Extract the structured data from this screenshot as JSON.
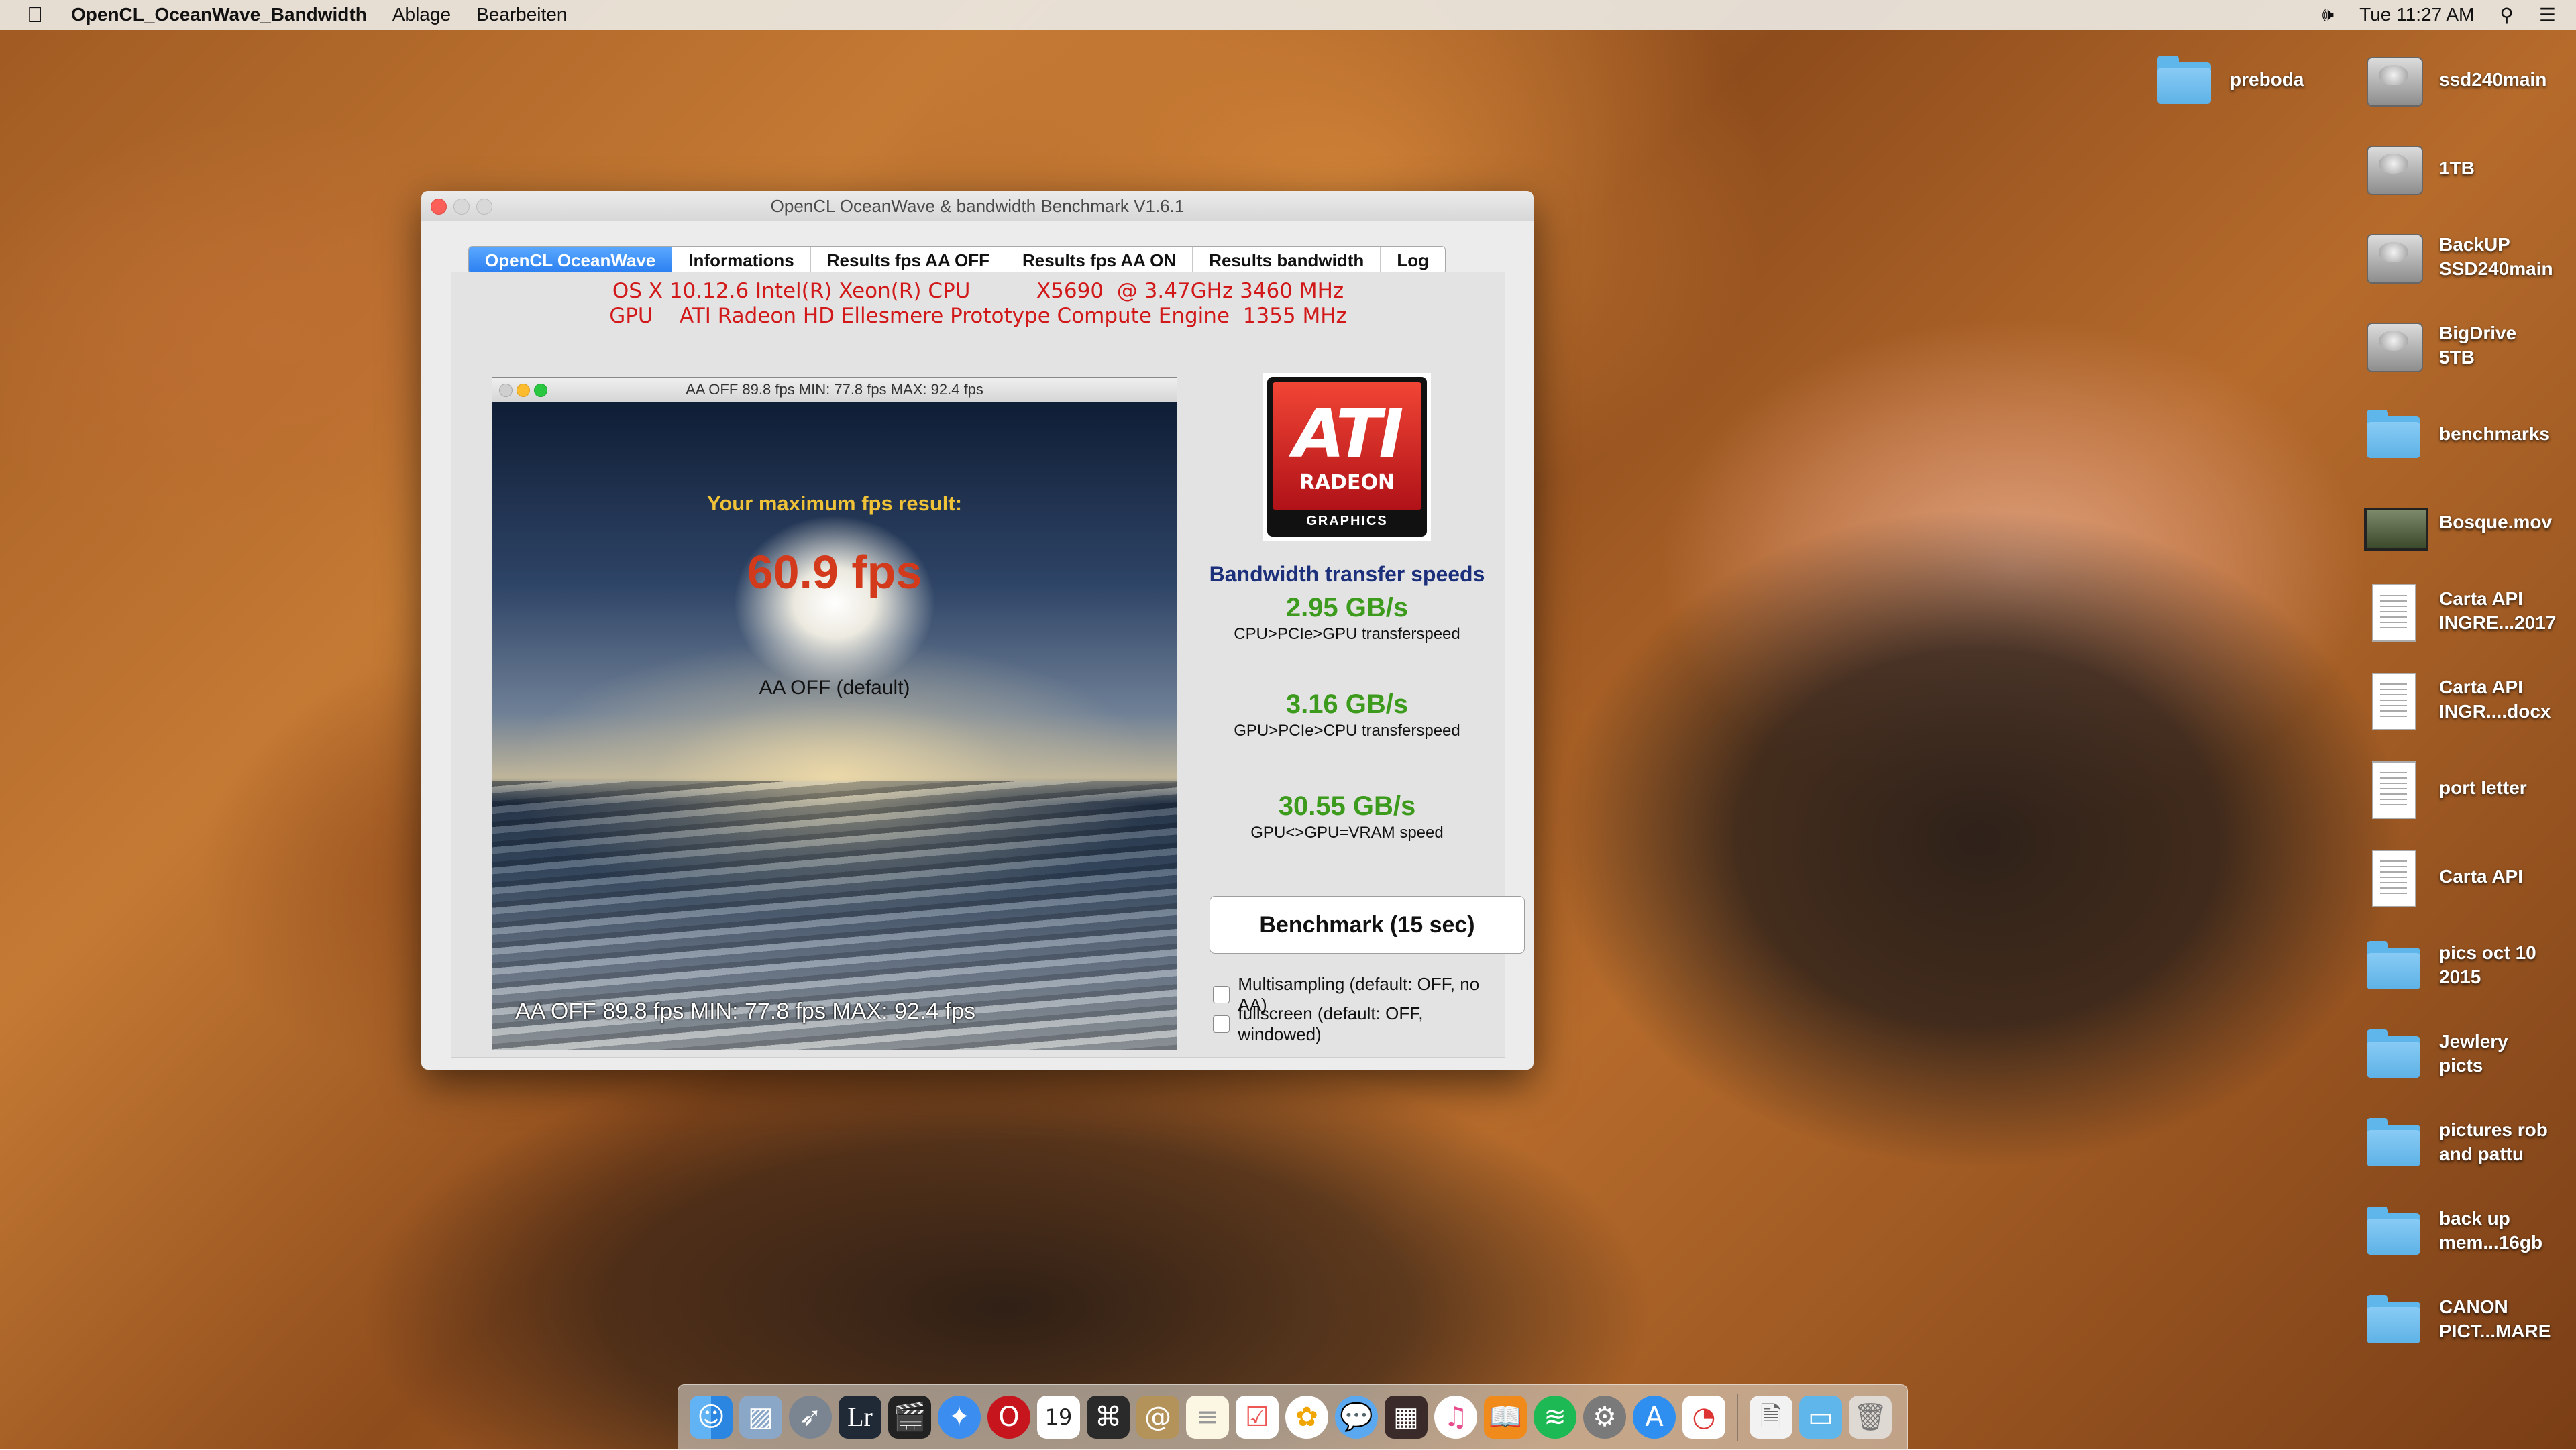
{
  "menubar": {
    "app_name": "OpenCL_OceanWave_Bandwidth",
    "menus": [
      "Ablage",
      "Bearbeiten"
    ],
    "clock": "Tue 11:27 AM"
  },
  "desktop_icons": [
    {
      "label": "preboda",
      "icon": "folder-icon"
    },
    {
      "label": "ssd240main",
      "icon": "hard-drive-icon"
    },
    {
      "label": "1TB",
      "icon": "hard-drive-icon"
    },
    {
      "label": "BackUP\nSSD240main",
      "icon": "hard-drive-icon"
    },
    {
      "label": "BigDrive\n5TB",
      "icon": "hard-drive-icon"
    },
    {
      "label": "benchmarks",
      "icon": "folder-icon"
    },
    {
      "label": "Bosque.mov",
      "icon": "movie-file-icon"
    },
    {
      "label": "Carta API\nINGRE...2017",
      "icon": "document-icon"
    },
    {
      "label": "Carta API\nINGR....docx",
      "icon": "docx-icon"
    },
    {
      "label": "port letter",
      "icon": "document-icon"
    },
    {
      "label": "Carta API",
      "icon": "docx-icon"
    },
    {
      "label": "pics oct 10\n2015",
      "icon": "folder-icon"
    },
    {
      "label": "Jewlery\npicts",
      "icon": "folder-icon"
    },
    {
      "label": "pictures rob\nand pattu",
      "icon": "folder-icon"
    },
    {
      "label": "back up\nmem...16gb",
      "icon": "folder-icon"
    },
    {
      "label": "CANON\nPICT...MARE",
      "icon": "folder-icon"
    }
  ],
  "window": {
    "title": "OpenCL OceanWave & bandwidth Benchmark V1.6.1",
    "tabs": [
      "OpenCL OceanWave",
      "Informations",
      "Results fps AA OFF",
      "Results fps AA ON",
      "Results bandwidth",
      "Log"
    ],
    "active_tab": 0,
    "sysinfo_line1": "OS X 10.12.6 Intel(R) Xeon(R) CPU          X5690  @ 3.47GHz 3460 MHz",
    "sysinfo_line2": "GPU    ATI Radeon HD Ellesmere Prototype Compute Engine  1355 MHz",
    "render_window": {
      "title": "AA OFF   89.8 fps MIN: 77.8 fps MAX: 92.4 fps",
      "max_fps_label": "Your maximum fps result:",
      "max_fps_value": "60.9 fps",
      "aa_mode": "AA OFF (default)",
      "overlay_text": "AA OFF   89.8 fps MIN: 77.8 fps MAX: 92.4 fps"
    },
    "logo": {
      "brand": "ATI",
      "line2": "RADEON",
      "line3": "GRAPHICS"
    },
    "bandwidth": {
      "title": "Bandwidth transfer speeds",
      "items": [
        {
          "value": "2.95 GB/s",
          "desc": "CPU>PCIe>GPU transferspeed"
        },
        {
          "value": "3.16 GB/s",
          "desc": "GPU>PCIe>CPU transferspeed"
        },
        {
          "value": "30.55 GB/s",
          "desc": "GPU<>GPU=VRAM speed"
        }
      ]
    },
    "benchmark_button": "Benchmark  (15 sec)",
    "options": [
      {
        "label": "Multisampling (default: OFF, no AA)",
        "checked": false
      },
      {
        "label": "fullscreen (default: OFF, windowed)",
        "checked": false
      }
    ]
  },
  "dock": {
    "apps": [
      "Finder",
      "Preview",
      "Launchpad",
      "Lightroom",
      "Final Cut",
      "Safari",
      "Opera",
      "Calendar",
      "Photo Booth",
      "Contacts",
      "Notes",
      "Reminders",
      "Photos",
      "Messages",
      "Photo Slideshow",
      "iTunes",
      "iBooks",
      "Spotify",
      "System Preferences",
      "App Store",
      "OpenCL",
      "Documents",
      "Downloads",
      "Trash"
    ],
    "calendar_day": "19"
  },
  "colors": {
    "tab_active": "#2a7ef0",
    "sysinfo_text": "#d1191a",
    "fps_label": "#f0c238",
    "fps_value": "#d33a1c",
    "bandwidth_title": "#1b2f7a",
    "bandwidth_value": "#3c9a1c"
  }
}
